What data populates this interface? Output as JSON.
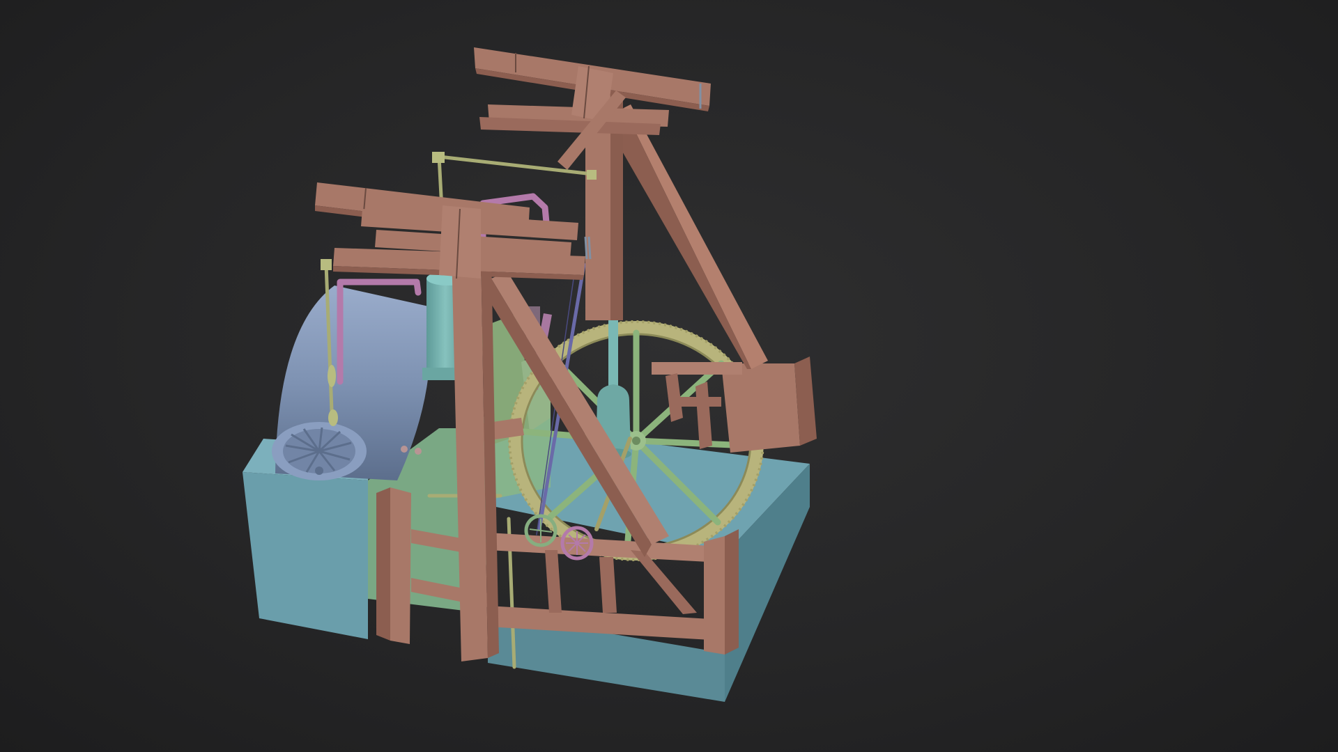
{
  "viewport": {
    "background_color": "#262627",
    "shading": "solid"
  },
  "model": {
    "materials": {
      "timber": "#a87868",
      "base": "#6ea0ac",
      "base_dark": "#5a8894",
      "green": "#7aa884",
      "light_green": "#9ac08a",
      "boiler": "#7e92b2",
      "teal": "#76b2ae",
      "pink": "#b47aaa",
      "gear": "#b8b47c",
      "rod": "#a8ac74"
    }
  }
}
